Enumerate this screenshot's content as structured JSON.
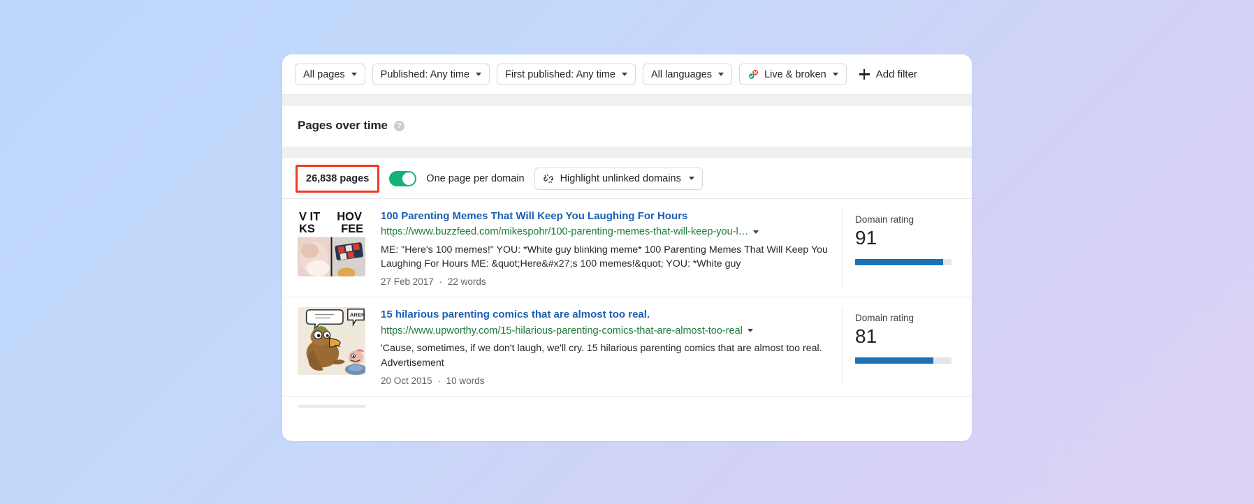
{
  "filter_bar": {
    "chips": [
      {
        "label": "All pages",
        "icon": null,
        "caret": true
      },
      {
        "label": "Published: Any time",
        "icon": null,
        "caret": true
      },
      {
        "label": "First published: Any time",
        "icon": null,
        "caret": true
      },
      {
        "label": "All languages",
        "icon": null,
        "caret": true
      },
      {
        "label": "Live & broken",
        "icon": "broken-link-icon",
        "caret": true
      }
    ],
    "add_filter_label": "Add filter",
    "add_filter_icon": "plus-icon"
  },
  "panel": {
    "title": "Pages over time",
    "help_icon": "help-question-icon",
    "help_glyph": "?"
  },
  "controls": {
    "pages_count": "26,838 pages",
    "pages_count_highlight_color": "#ef3b22",
    "toggle_on": true,
    "toggle_color": "#13b376",
    "toggle_label": "One page per domain",
    "highlight_button_label": "Highlight unlinked domains",
    "highlight_button_icon": "unlink-icon"
  },
  "results": {
    "dr_column_label": "Domain rating",
    "items": [
      {
        "thumb_name": "meme-collage-thumbnail",
        "title": "100 Parenting Memes That Will Keep You Laughing For Hours",
        "url": "https://www.buzzfeed.com/mikespohr/100-parenting-memes-that-will-keep-you-l…",
        "description": "ME: \"Here's 100 memes!\" YOU: *White guy blinking meme* 100 Parenting Memes That Will Keep You Laughing For Hours ME: &quot;Here&#x27;s 100 memes!&quot; YOU: *White guy",
        "date": "27 Feb 2017",
        "words": "22 words",
        "domain_rating": "91",
        "domain_rating_pct": 91
      },
      {
        "thumb_name": "duck-cartoon-thumbnail",
        "title": "15 hilarious parenting comics that are almost too real.",
        "url": "https://www.upworthy.com/15-hilarious-parenting-comics-that-are-almost-too-real",
        "description": "'Cause, sometimes, if we don't laugh, we'll cry. 15 hilarious parenting comics that are almost too real. Advertisement",
        "date": "20 Oct 2015",
        "words": "10 words",
        "domain_rating": "81",
        "domain_rating_pct": 81
      }
    ],
    "meta_separator": "·"
  },
  "theme": {
    "link_blue": "#1a5fb4",
    "url_green": "#1e7b3c",
    "bar_blue": "#1a73b8",
    "toggle_green": "#13b376",
    "highlight_red": "#ef3b22"
  }
}
